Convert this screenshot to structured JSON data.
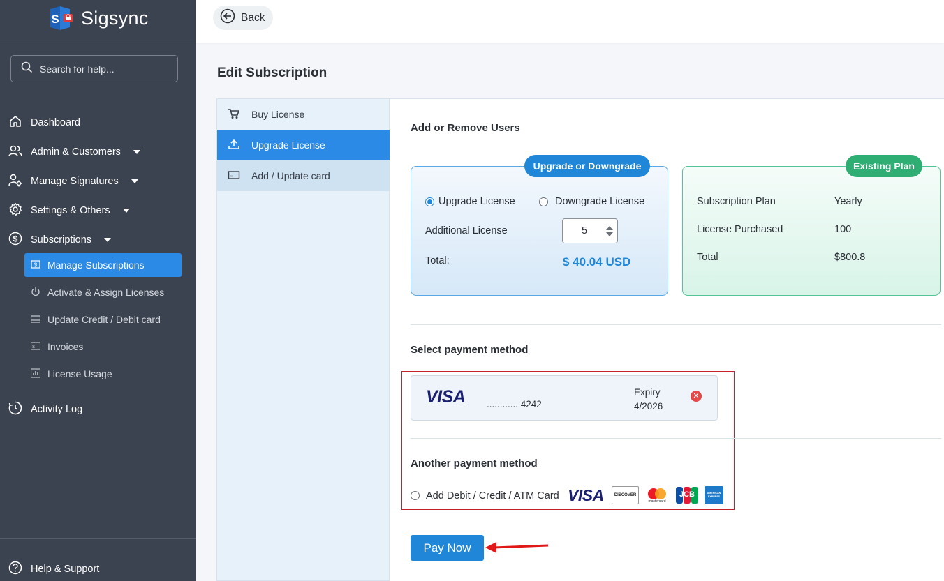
{
  "app": {
    "name": "Sigsync"
  },
  "search": {
    "placeholder": "Search for help..."
  },
  "sidebar": {
    "items": [
      {
        "label": "Dashboard"
      },
      {
        "label": "Admin & Customers"
      },
      {
        "label": "Manage Signatures"
      },
      {
        "label": "Settings & Others"
      },
      {
        "label": "Subscriptions"
      }
    ],
    "sub_items": [
      {
        "label": "Manage Subscriptions",
        "active": true
      },
      {
        "label": "Activate & Assign Licenses"
      },
      {
        "label": "Update Credit / Debit card"
      },
      {
        "label": "Invoices"
      },
      {
        "label": "License Usage"
      }
    ],
    "activity_log": "Activity Log",
    "help": "Help & Support"
  },
  "topbar": {
    "back_label": "Back"
  },
  "page": {
    "title": "Edit Subscription"
  },
  "tabs": [
    {
      "label": "Buy License",
      "icon": "cart-icon"
    },
    {
      "label": "Upgrade License",
      "icon": "upload-icon",
      "active": true
    },
    {
      "label": "Add / Update card",
      "icon": "card-icon"
    }
  ],
  "users": {
    "heading": "Add or Remove Users",
    "upgrade_card": {
      "badge": "Upgrade or Downgrade",
      "option_upgrade": "Upgrade License",
      "option_downgrade": "Downgrade License",
      "selected": "Upgrade License",
      "additional_label": "Additional License",
      "additional_value": "5",
      "total_label": "Total:",
      "total_value": "$ 40.04 USD"
    },
    "existing_plan": {
      "badge": "Existing Plan",
      "rows": [
        {
          "label": "Subscription Plan",
          "value": "Yearly"
        },
        {
          "label": "License Purchased",
          "value": "100"
        },
        {
          "label": "Total",
          "value": "$800.8"
        }
      ]
    }
  },
  "payment": {
    "heading": "Select payment method",
    "saved_card": {
      "brand": "VISA",
      "masked": "............ 4242",
      "expiry_label": "Expiry",
      "expiry_value": "4/2026"
    },
    "another_heading": "Another payment method",
    "add_card_label": "Add Debit / Credit / ATM Card",
    "brands": [
      "VISA",
      "DISCOVER",
      "mastercard",
      "JCB",
      "AMERICAN EXPRESS"
    ]
  },
  "pay_button": "Pay Now",
  "colors": {
    "sidebar": "#3c4350",
    "accent": "#2b8ae6",
    "green": "#2fae74",
    "highlight_border": "#c8202a"
  }
}
